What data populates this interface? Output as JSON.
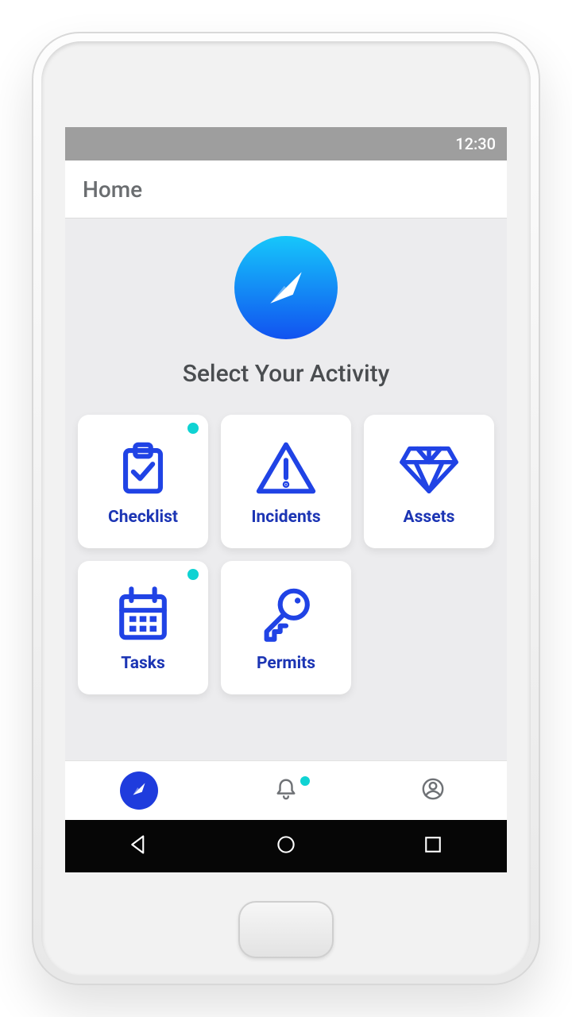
{
  "status": {
    "time": "12:30"
  },
  "appbar": {
    "title": "Home"
  },
  "hero": {
    "title": "Select Your Activity"
  },
  "activities": [
    {
      "label": "Checklist",
      "icon": "clipboard-check-icon",
      "badge": true
    },
    {
      "label": "Incidents",
      "icon": "warning-triangle-icon",
      "badge": false
    },
    {
      "label": "Assets",
      "icon": "diamond-icon",
      "badge": false
    },
    {
      "label": "Tasks",
      "icon": "calendar-grid-icon",
      "badge": true
    },
    {
      "label": "Permits",
      "icon": "key-icon",
      "badge": false
    }
  ],
  "tabs": {
    "explore_active": true,
    "alerts_badge": true
  },
  "colors": {
    "primary": "#1f3cdd",
    "accent": "#0fd3d3"
  }
}
